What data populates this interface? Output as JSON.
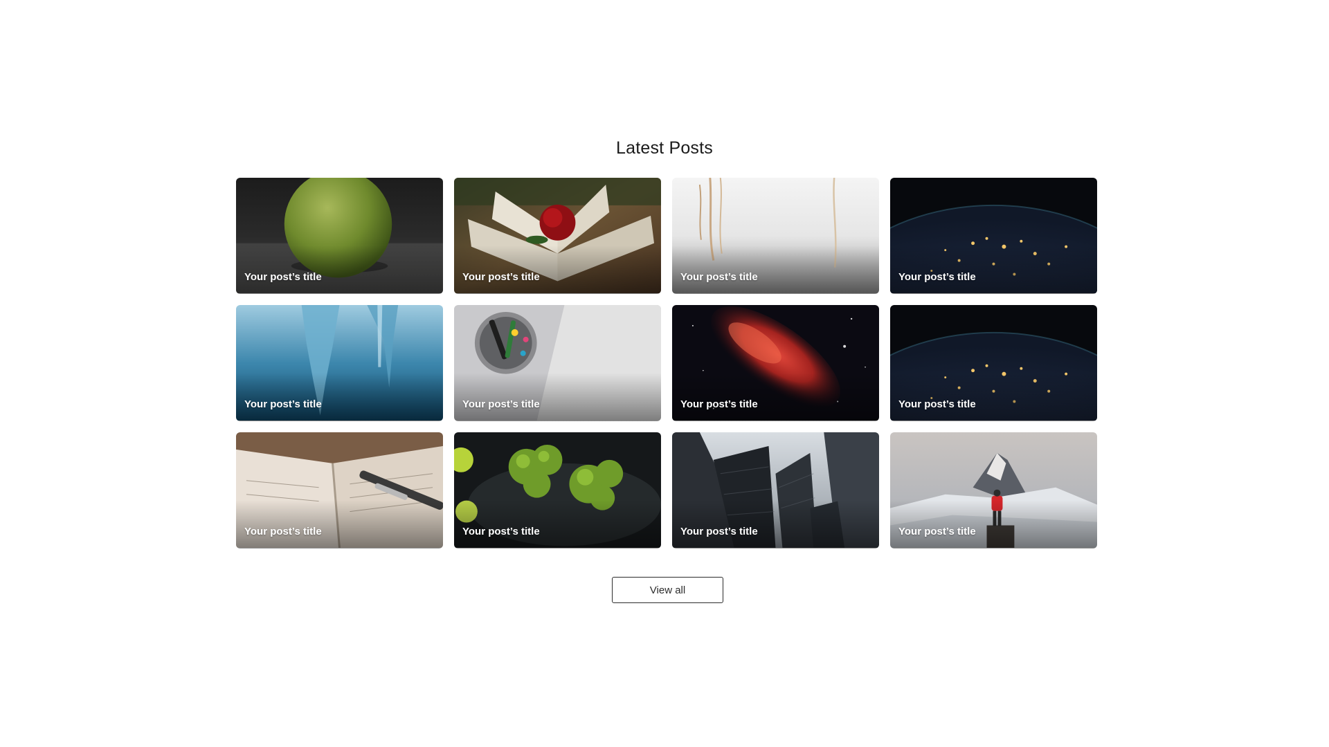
{
  "section": {
    "title": "Latest Posts",
    "view_all_label": "View all"
  },
  "posts": [
    {
      "title": "Your post’s title",
      "image": "pear"
    },
    {
      "title": "Your post’s title",
      "image": "book-rose"
    },
    {
      "title": "Your post’s title",
      "image": "white-reeds"
    },
    {
      "title": "Your post’s title",
      "image": "earth-night"
    },
    {
      "title": "Your post’s title",
      "image": "icicles"
    },
    {
      "title": "Your post’s title",
      "image": "markers-jar"
    },
    {
      "title": "Your post’s title",
      "image": "nebula"
    },
    {
      "title": "Your post’s title",
      "image": "earth-night"
    },
    {
      "title": "Your post’s title",
      "image": "fountain-pen-notebook"
    },
    {
      "title": "Your post’s title",
      "image": "broccoli-plate"
    },
    {
      "title": "Your post’s title",
      "image": "skyscrapers"
    },
    {
      "title": "Your post’s title",
      "image": "mountain-hiker"
    }
  ]
}
